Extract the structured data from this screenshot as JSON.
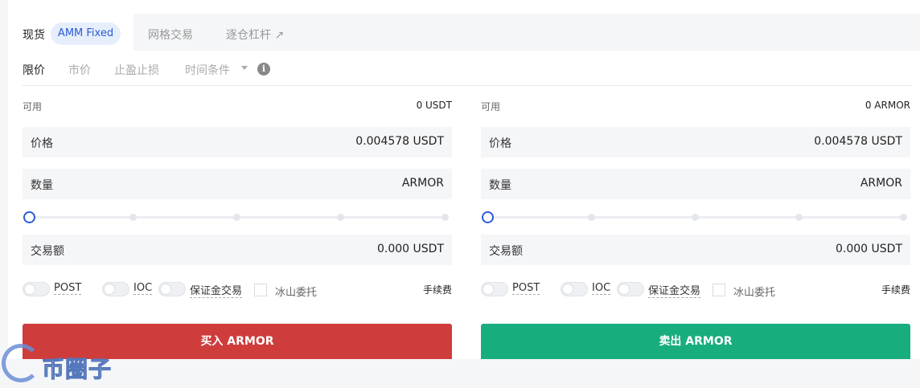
{
  "tabs": {
    "spot": "现货",
    "amm": "AMM Fixed",
    "grid": "网格交易",
    "margin": "逐仓杠杆 ↗"
  },
  "order_types": {
    "limit": "限价",
    "market": "市价",
    "tp_sl": "止盈止损",
    "time_cond": "时间条件",
    "info": "i"
  },
  "buy": {
    "available_label": "可用",
    "available_value": "0 USDT",
    "price_label": "价格",
    "price_value": "0.004578 USDT",
    "qty_label": "数量",
    "qty_value": "ARMOR",
    "slider_percent": 0,
    "total_label": "交易额",
    "total_value": "0.000 USDT",
    "opt_post": "POST",
    "opt_ioc": "IOC",
    "opt_margin": "保证金交易",
    "opt_iceberg": "冰山委托",
    "fee": "手续费",
    "button": "买入 ARMOR",
    "button_color": "#cf3c3c"
  },
  "sell": {
    "available_label": "可用",
    "available_value": "0 ARMOR",
    "price_label": "价格",
    "price_value": "0.004578 USDT",
    "qty_label": "数量",
    "qty_value": "ARMOR",
    "slider_percent": 0,
    "total_label": "交易额",
    "total_value": "0.000 USDT",
    "opt_post": "POST",
    "opt_ioc": "IOC",
    "opt_margin": "保证金交易",
    "opt_iceberg": "冰山委托",
    "fee": "手续费",
    "button": "卖出 ARMOR",
    "button_color": "#18ad7e"
  },
  "watermark": {
    "text": "币圈子"
  },
  "accent_color": "#2a5bd7"
}
